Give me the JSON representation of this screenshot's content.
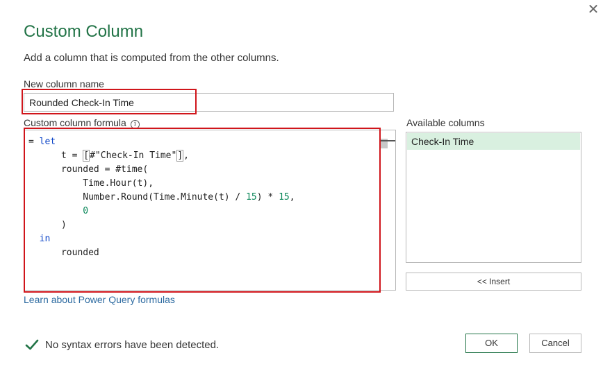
{
  "dialog": {
    "title": "Custom Column",
    "subtitle": "Add a column that is computed from the other columns.",
    "close_icon": "close-icon"
  },
  "name_field": {
    "label": "New column name",
    "value": "Rounded Check-In Time"
  },
  "formula": {
    "label": "Custom column formula",
    "info_icon": "info-icon",
    "info_glyph": "i",
    "lines": [
      {
        "indent": "",
        "parts": [
          [
            "plain",
            "= "
          ],
          [
            "kw",
            "let"
          ]
        ]
      },
      {
        "indent": "      ",
        "parts": [
          [
            "plain",
            "t = "
          ],
          [
            "brk",
            "["
          ],
          [
            "plain",
            "#\"Check-In Time\""
          ],
          [
            "brk",
            "]"
          ],
          [
            "plain",
            ","
          ]
        ]
      },
      {
        "indent": "      ",
        "parts": [
          [
            "plain",
            "rounded = #time("
          ]
        ]
      },
      {
        "indent": "          ",
        "parts": [
          [
            "plain",
            "Time.Hour(t),"
          ]
        ]
      },
      {
        "indent": "          ",
        "parts": [
          [
            "plain",
            "Number.Round(Time.Minute(t) / "
          ],
          [
            "num",
            "15"
          ],
          [
            "plain",
            ") * "
          ],
          [
            "num",
            "15"
          ],
          [
            "plain",
            ","
          ]
        ]
      },
      {
        "indent": "          ",
        "parts": [
          [
            "num",
            "0"
          ]
        ]
      },
      {
        "indent": "      ",
        "parts": [
          [
            "plain",
            ")"
          ]
        ]
      },
      {
        "indent": "  ",
        "parts": [
          [
            "kw",
            "in"
          ]
        ]
      },
      {
        "indent": "      ",
        "parts": [
          [
            "plain",
            "rounded"
          ]
        ]
      }
    ]
  },
  "available_columns": {
    "label": "Available columns",
    "items": [
      "Check-In Time"
    ],
    "insert_label": "<< Insert"
  },
  "learn_link": "Learn about Power Query formulas",
  "status": {
    "icon": "checkmark-icon",
    "text": "No syntax errors have been detected."
  },
  "buttons": {
    "ok": "OK",
    "cancel": "Cancel"
  },
  "colors": {
    "title": "#217346",
    "keyword": "#0b43c7",
    "number": "#098658",
    "highlight": "#d0151b",
    "selected_item": "#d9f0e0",
    "link": "#2c6aa0"
  }
}
